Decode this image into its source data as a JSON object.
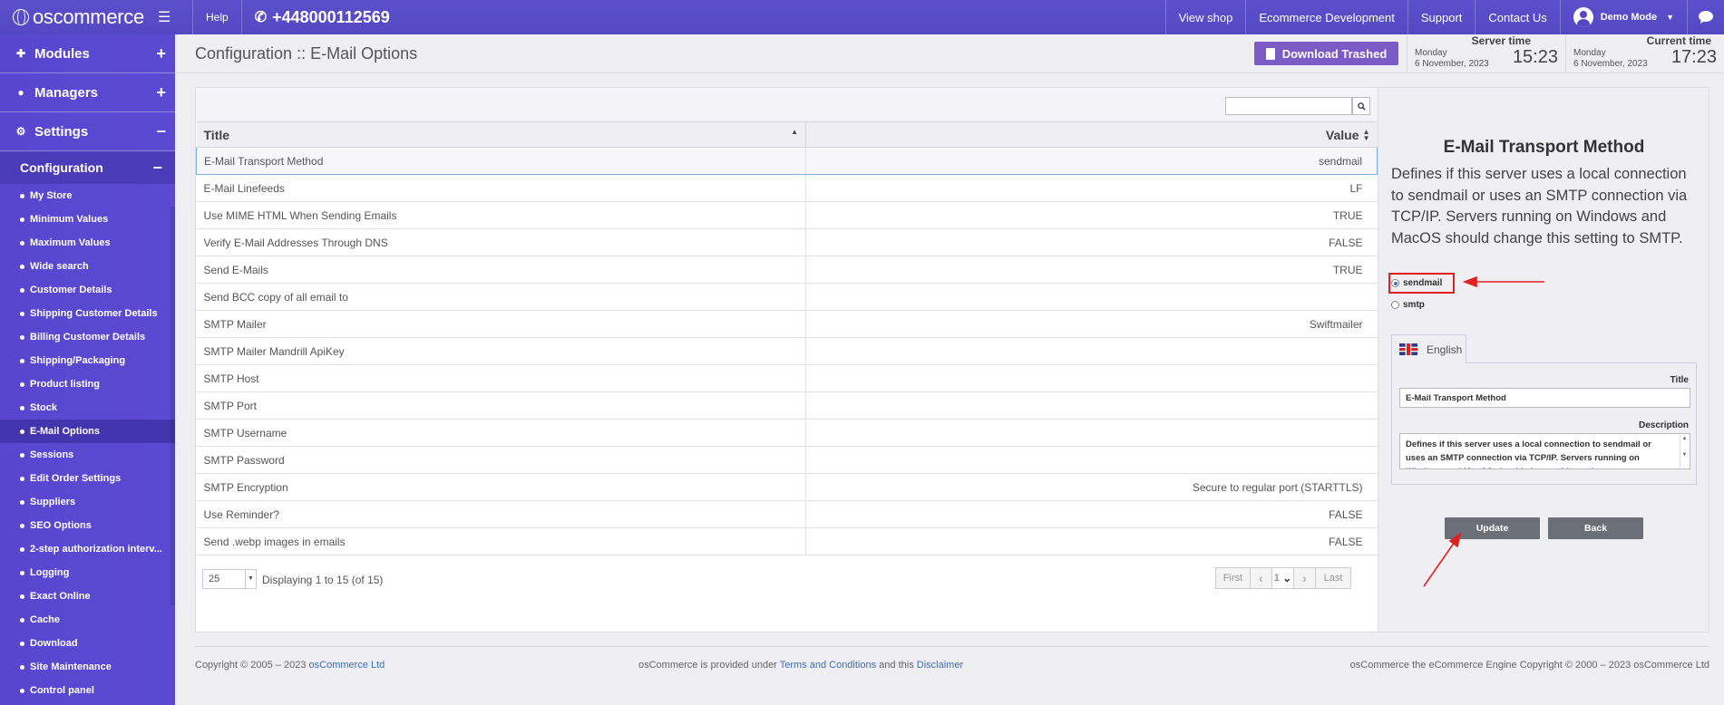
{
  "topbar": {
    "logo": "oscommerce",
    "help": "Help",
    "phone": "+448000112569",
    "nav": [
      "View shop",
      "Ecommerce Development",
      "Support",
      "Contact Us"
    ],
    "user": "Demo Mode"
  },
  "sidebar": {
    "sections": [
      {
        "label": "Modules",
        "icon": "puzzle-icon",
        "toggle": "+"
      },
      {
        "label": "Managers",
        "icon": "user-icon",
        "toggle": "+"
      },
      {
        "label": "Settings",
        "icon": "gears-icon",
        "toggle": "−"
      }
    ],
    "config_label": "Configuration",
    "config_toggle": "−",
    "items": [
      "My Store",
      "Minimum Values",
      "Maximum Values",
      "Wide search",
      "Customer Details",
      "Shipping Customer Details",
      "Billing Customer Details",
      "Shipping/Packaging",
      "Product listing",
      "Stock",
      "E-Mail Options",
      "Sessions",
      "Edit Order Settings",
      "Suppliers",
      "SEO Options",
      "2-step authorization interv...",
      "Logging",
      "Exact Online",
      "Cache",
      "Download",
      "Site Maintenance",
      "Control panel"
    ],
    "active_item": "E-Mail Options"
  },
  "header": {
    "title": "Configuration :: E-Mail Options",
    "download_label": "Download Trashed",
    "server_time": {
      "label": "Server time",
      "day": "Monday",
      "date": "6 November, 2023",
      "time": "15:23"
    },
    "current_time": {
      "label": "Current time",
      "day": "Monday",
      "date": "6 November, 2023",
      "time": "17:23"
    }
  },
  "table": {
    "columns": [
      "Title",
      "Value"
    ],
    "rows": [
      {
        "title": "E-Mail Transport Method",
        "value": "sendmail"
      },
      {
        "title": "E-Mail Linefeeds",
        "value": "LF"
      },
      {
        "title": "Use MIME HTML When Sending Emails",
        "value": "TRUE"
      },
      {
        "title": "Verify E-Mail Addresses Through DNS",
        "value": "FALSE"
      },
      {
        "title": "Send E-Mails",
        "value": "TRUE"
      },
      {
        "title": "Send BCC copy of all email to",
        "value": ""
      },
      {
        "title": "SMTP Mailer",
        "value": "Swiftmailer"
      },
      {
        "title": "SMTP Mailer Mandrill ApiKey",
        "value": ""
      },
      {
        "title": "SMTP Host",
        "value": ""
      },
      {
        "title": "SMTP Port",
        "value": ""
      },
      {
        "title": "SMTP Username",
        "value": ""
      },
      {
        "title": "SMTP Password",
        "value": ""
      },
      {
        "title": "SMTP Encryption",
        "value": "Secure to regular port (STARTTLS)"
      },
      {
        "title": "Use Reminder?",
        "value": "FALSE"
      },
      {
        "title": "Send .webp images in emails",
        "value": "FALSE"
      }
    ],
    "per_page": "25",
    "displaying": "Displaying 1 to 15 (of 15)",
    "pager": {
      "first": "First",
      "page": "1",
      "last": "Last"
    }
  },
  "panel": {
    "title": "E-Mail Transport Method",
    "description": "Defines if this server uses a local connection to sendmail or uses an SMTP connection via TCP/IP. Servers running on Windows and MacOS should change this setting to SMTP.",
    "options": [
      "sendmail",
      "smtp"
    ],
    "selected": "sendmail",
    "lang_tab": "English",
    "title_label": "Title",
    "title_value": "E-Mail Transport Method",
    "desc_label": "Description",
    "desc_value": "Defines if this server uses a local connection to sendmail or uses an SMTP connection via TCP/IP. Servers running on Windows and MacOS should change this setting to",
    "update_label": "Update",
    "back_label": "Back"
  },
  "footer": {
    "copy_prefix": "Copyright © 2005 – 2023",
    "copy_link": "osCommerce Ltd",
    "center_prefix": "osCommerce is provided under",
    "terms_link": "Terms and Conditions",
    "center_mid": "and this",
    "disclaimer_link": "Disclaimer",
    "right": "osCommerce the eCommerce Engine Copyright © 2000 – 2023 osCommerce Ltd"
  },
  "colors": {
    "brand": "#5a4ad1",
    "accent_button": "#7b5cc7",
    "highlight": "#e02020"
  }
}
